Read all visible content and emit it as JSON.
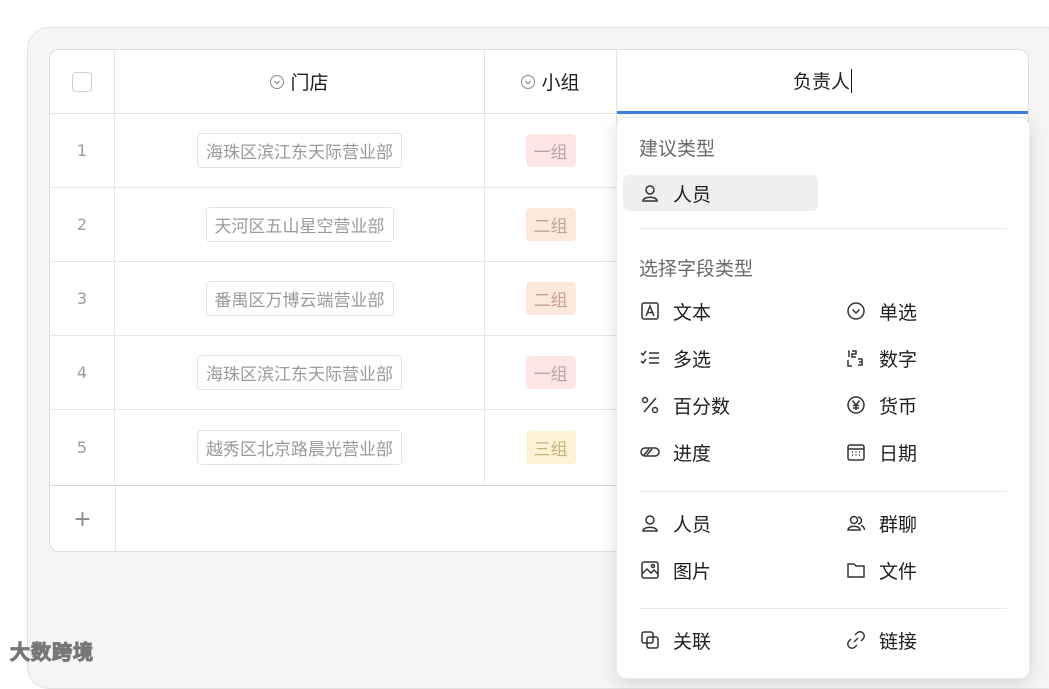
{
  "table": {
    "columns": [
      {
        "label": "门店"
      },
      {
        "label": "小组"
      },
      {
        "label": "负责人"
      }
    ],
    "rows": [
      {
        "index": "1",
        "store": "海珠区滨江东天际营业部",
        "group": "一组",
        "group_color": "red"
      },
      {
        "index": "2",
        "store": "天河区五山星空营业部",
        "group": "二组",
        "group_color": "orange"
      },
      {
        "index": "3",
        "store": "番禺区万博云端营业部",
        "group": "二组",
        "group_color": "orange"
      },
      {
        "index": "4",
        "store": "海珠区滨江东天际营业部",
        "group": "一组",
        "group_color": "red"
      },
      {
        "index": "5",
        "store": "越秀区北京路晨光营业部",
        "group": "三组",
        "group_color": "yellow"
      }
    ],
    "add_row_label": "+"
  },
  "menu": {
    "suggested_title": "建议类型",
    "suggested": [
      {
        "label": "人员",
        "icon": "person-icon"
      }
    ],
    "field_title": "选择字段类型",
    "fields": [
      {
        "label": "文本",
        "icon": "text-icon"
      },
      {
        "label": "单选",
        "icon": "single-select-icon"
      },
      {
        "label": "多选",
        "icon": "multi-select-icon"
      },
      {
        "label": "数字",
        "icon": "number-icon"
      },
      {
        "label": "百分数",
        "icon": "percent-icon"
      },
      {
        "label": "货币",
        "icon": "currency-icon"
      },
      {
        "label": "进度",
        "icon": "progress-icon"
      },
      {
        "label": "日期",
        "icon": "calendar-icon"
      }
    ],
    "people": [
      {
        "label": "人员",
        "icon": "person-icon"
      },
      {
        "label": "群聊",
        "icon": "group-chat-icon"
      },
      {
        "label": "图片",
        "icon": "image-icon"
      },
      {
        "label": "文件",
        "icon": "folder-icon"
      }
    ],
    "links": [
      {
        "label": "关联",
        "icon": "relation-icon"
      },
      {
        "label": "链接",
        "icon": "link-icon"
      }
    ]
  },
  "watermark": "大数跨境",
  "colors": {
    "accent": "#3d7fe0",
    "group_red": "#fde6e3",
    "group_orange": "#fde8dc",
    "group_yellow": "#fdf3d6"
  }
}
